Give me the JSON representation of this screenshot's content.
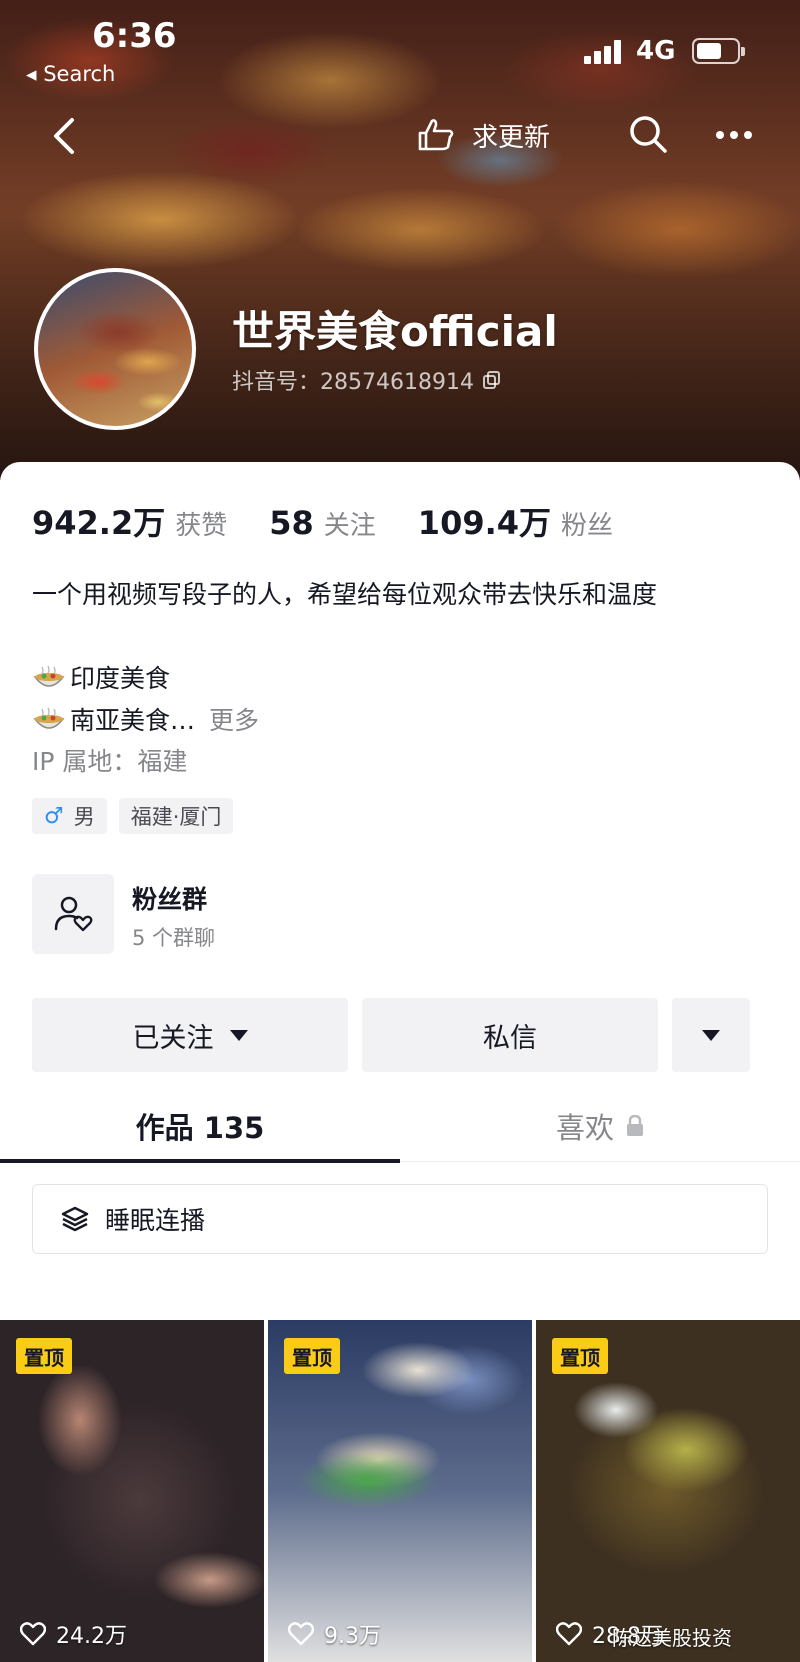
{
  "status_bar": {
    "time": "6:36",
    "back_app": "◂ Search",
    "network": "4G"
  },
  "nav": {
    "request_update_label": "求更新"
  },
  "profile": {
    "display_name": "世界美食official",
    "user_id": "抖音号：28574618914"
  },
  "stats": [
    {
      "value": "942.2万",
      "label": "获赞"
    },
    {
      "value": "58",
      "label": "关注"
    },
    {
      "value": "109.4万",
      "label": "粉丝"
    }
  ],
  "bio": {
    "line1": "一个用视频写段子的人，希望给每位观众带去快乐和温度",
    "line2": "印度美食",
    "line3": "南亚美食…",
    "more": "更多",
    "ip": "IP 属地：福建"
  },
  "tags": {
    "gender": "男",
    "location": "福建·厦门"
  },
  "fan_group": {
    "title": "粉丝群",
    "subtitle": "5 个群聊"
  },
  "actions": {
    "followed_label": "已关注",
    "message_label": "私信"
  },
  "tabs": {
    "works": "作品 135",
    "likes": "喜欢"
  },
  "collection": {
    "label": "睡眠连播"
  },
  "videos": [
    {
      "pin": "置顶",
      "likes": "24.2万"
    },
    {
      "pin": "置顶",
      "likes": "9.3万"
    },
    {
      "pin": "置顶",
      "likes": "28.8万"
    }
  ],
  "watermark": "陈达美股投资",
  "colors": {
    "accent_pin": "#facc15",
    "gender_blue": "#2f8ff0",
    "text_primary": "#161823",
    "text_secondary": "#86878b"
  }
}
